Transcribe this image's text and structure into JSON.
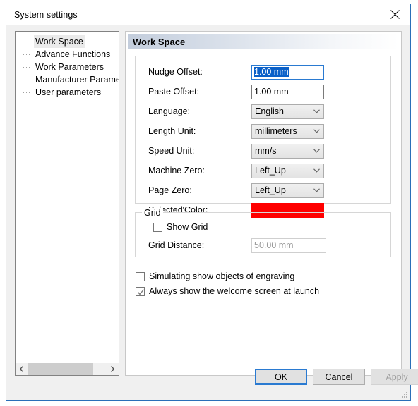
{
  "window": {
    "title": "System settings",
    "close_icon": "close-icon"
  },
  "sidebar": {
    "items": [
      {
        "label": "Work Space",
        "selected": true
      },
      {
        "label": "Advance Functions",
        "selected": false
      },
      {
        "label": "Work Parameters",
        "selected": false
      },
      {
        "label": "Manufacturer Paramet",
        "selected": false
      },
      {
        "label": "User parameters",
        "selected": false
      }
    ],
    "scrollbar": {
      "left_arrow_icon": "chevron-left-icon",
      "right_arrow_icon": "chevron-right-icon"
    }
  },
  "page": {
    "header": "Work Space",
    "fields": [
      {
        "label": "Nudge Offset:",
        "value": "1.00 mm",
        "type": "text",
        "focused": true
      },
      {
        "label": "Paste Offset:",
        "value": "1.00 mm",
        "type": "text",
        "focused": false
      },
      {
        "label": "Language:",
        "value": "English",
        "type": "combo"
      },
      {
        "label": "Length Unit:",
        "value": "millimeters",
        "type": "combo"
      },
      {
        "label": "Speed Unit:",
        "value": "mm/s",
        "type": "combo"
      },
      {
        "label": "Machine Zero:",
        "value": "Left_Up",
        "type": "combo"
      },
      {
        "label": "Page Zero:",
        "value": "Left_Up",
        "type": "combo"
      },
      {
        "label": "Selected'Color:",
        "value": "#FF0000",
        "type": "color"
      }
    ],
    "grid_group": {
      "legend": "Grid",
      "show_grid": {
        "label": "Show Grid",
        "checked": false
      },
      "grid_distance": {
        "label": "Grid Distance:",
        "value": "50.00 mm",
        "disabled": true
      }
    },
    "options": [
      {
        "label": "Simulating show objects of engraving",
        "checked": false
      },
      {
        "label": "Always show the welcome screen at launch",
        "checked": true
      }
    ]
  },
  "buttons": {
    "ok": "OK",
    "cancel": "Cancel",
    "apply_accel": "A",
    "apply_rest": "pply"
  },
  "colors": {
    "selected_color": "#FF0000",
    "accent": "#2A7AD1",
    "selection_highlight": "#0A60C8"
  }
}
